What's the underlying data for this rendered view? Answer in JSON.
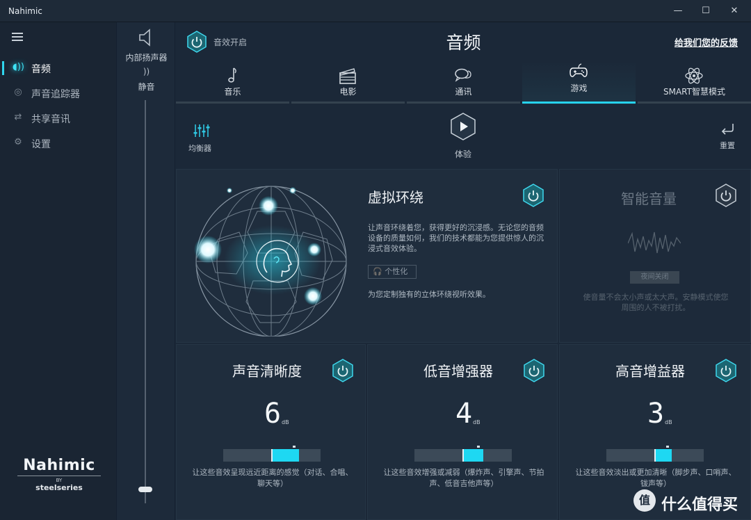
{
  "window": {
    "title": "Nahimic",
    "minimize": "—",
    "maximize": "☐",
    "close": "✕"
  },
  "sidebar": {
    "items": [
      {
        "label": "音频",
        "icon": "audio-wave-icon",
        "active": true
      },
      {
        "label": "声音追踪器",
        "icon": "sound-tracker-icon",
        "active": false
      },
      {
        "label": "共享音讯",
        "icon": "share-audio-icon",
        "active": false
      },
      {
        "label": "设置",
        "icon": "gear-icon",
        "active": false
      }
    ],
    "logo": {
      "brand": "Nahimic",
      "by": "BY",
      "partner": "steelseries"
    }
  },
  "volume_panel": {
    "device": "内部扬声器",
    "mute_label": "静音",
    "volume_level": 0.04
  },
  "header": {
    "effects_toggle_label": "音效开启",
    "title": "音频",
    "feedback_link": "给我们您的反馈"
  },
  "tabs": [
    {
      "label": "音乐",
      "icon": "music-note-icon",
      "active": false
    },
    {
      "label": "电影",
      "icon": "clapperboard-icon",
      "active": false
    },
    {
      "label": "通讯",
      "icon": "chat-bubbles-icon",
      "active": false
    },
    {
      "label": "游戏",
      "icon": "gamepad-icon",
      "active": true
    },
    {
      "label": "SMART智慧模式",
      "icon": "atom-icon",
      "active": false
    }
  ],
  "toolbar": {
    "equalizer_label": "均衡器",
    "play_label": "体验",
    "reset_label": "重置"
  },
  "virtual_surround": {
    "title": "虚拟环绕",
    "description": "让声音环绕着您，获得更好的沉浸感。无论您的音频设备的质量如何，我们的技术都能为您提供惊人的沉浸式音效体验。",
    "personalize_label": "个性化",
    "note": "为您定制独有的立体环绕视听效果。"
  },
  "smart_volume": {
    "title": "智能音量",
    "button_label": "夜间关闭",
    "description": "使音量不会太小声或太大声。安静模式使您周围的人不被打扰。"
  },
  "effects": [
    {
      "title": "声音清晰度",
      "value": "6",
      "unit": "dB",
      "level": 0.47,
      "description": "让这些音效呈现远近距离的感觉（对话、合唱、聊天等）"
    },
    {
      "title": "低音增强器",
      "value": "4",
      "unit": "dB",
      "level": 0.33,
      "description": "让这些音效增强或减弱（爆炸声、引擎声、节拍声、低音吉他声等）"
    },
    {
      "title": "高音增益器",
      "value": "3",
      "unit": "dB",
      "level": 0.25,
      "description": "让这些音效淡出或更加清晰（脚步声、口哨声、钹声等）"
    }
  ],
  "watermark": {
    "text": "什么值得买",
    "badge": "值"
  },
  "colors": {
    "accent": "#27d2ec",
    "background": "#1b2838",
    "card": "#1f2d3d"
  }
}
